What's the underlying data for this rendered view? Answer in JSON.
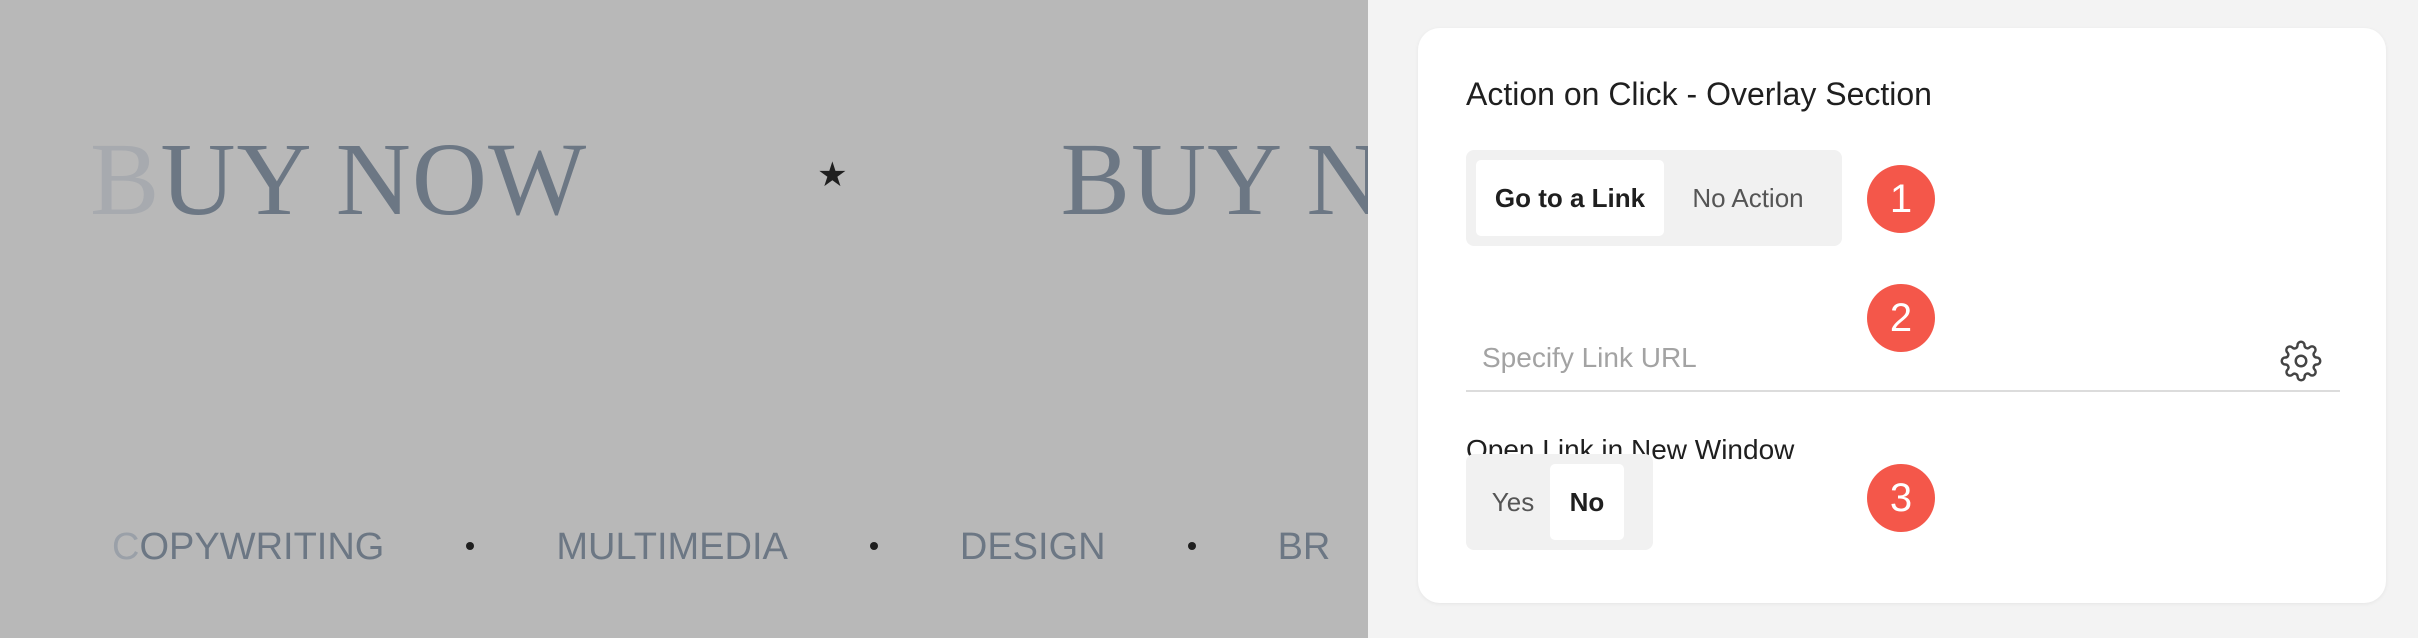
{
  "preview": {
    "headline_repeats": [
      "BUY NOW",
      "BUY N"
    ],
    "headline_separator": "★",
    "ticker_items": [
      "COPYWRITING",
      "MULTIMEDIA",
      "DESIGN",
      "BR"
    ]
  },
  "panel": {
    "title": "Action on Click - Overlay Section",
    "action_options": [
      "Go to a Link",
      "No Action"
    ],
    "action_selected": "Go to a Link",
    "link_url": {
      "value": "",
      "placeholder": "Specify Link URL"
    },
    "settings_icon": "gear-icon",
    "new_window_label": "Open Link in New Window",
    "new_window_options": [
      "Yes",
      "No"
    ],
    "new_window_selected": "No"
  },
  "annotations": [
    "1",
    "2",
    "3"
  ],
  "colors": {
    "overlay_gray": "#b8b8b8",
    "preview_text": "#6c7784",
    "panel_bg": "#f3f3f3",
    "card_bg": "#ffffff",
    "badge": "#f4574a",
    "segment_bg": "#f1f1f1"
  }
}
